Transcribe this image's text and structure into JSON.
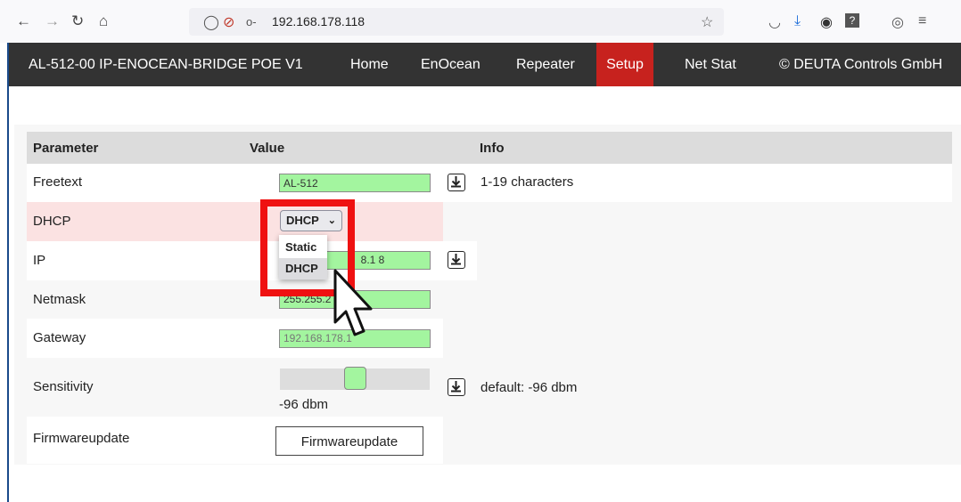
{
  "browser": {
    "url": "192.168.178.118",
    "icons": [
      "back-arrow-icon",
      "forward-arrow-icon",
      "reload-icon",
      "home-icon",
      "shield-icon",
      "permissions-icon",
      "key-icon",
      "bookmark-star-icon",
      "pocket-icon",
      "download-icon",
      "extension-icon",
      "help-icon",
      "account-icon",
      "menu-icon"
    ]
  },
  "nav": {
    "brand": "AL-512-00 IP-ENOCEAN-BRIDGE POE V1",
    "items": [
      "Home",
      "EnOcean",
      "Repeater",
      "Setup",
      "Net Stat"
    ],
    "active": "Setup",
    "copyright": "© DEUTA Controls GmbH",
    "active_color": "#c7221e"
  },
  "table": {
    "headers": {
      "parameter": "Parameter",
      "value": "Value",
      "info": "Info"
    },
    "rows": {
      "freetext": {
        "label": "Freetext",
        "value": "AL-512",
        "info": "1-19 characters"
      },
      "dhcp": {
        "label": "DHCP",
        "selected": "DHCP",
        "options": [
          "Static",
          "DHCP"
        ]
      },
      "ip": {
        "label": "IP",
        "value_partial": "8.1 8"
      },
      "netmask": {
        "label": "Netmask",
        "value_partial": "255.255.2"
      },
      "gateway": {
        "label": "Gateway",
        "value": "192.168.178.1"
      },
      "sensitivity": {
        "label": "Sensitivity",
        "value": "-96 dbm",
        "info": "default: -96 dbm",
        "slider_fraction": 0.45
      },
      "firmwareupdate": {
        "label": "Firmwareupdate",
        "button": "Firmwareupdate"
      }
    }
  },
  "colors": {
    "input_bg": "#a3f59f",
    "highlight_red": "#ef1111",
    "navbar": "#333333"
  }
}
